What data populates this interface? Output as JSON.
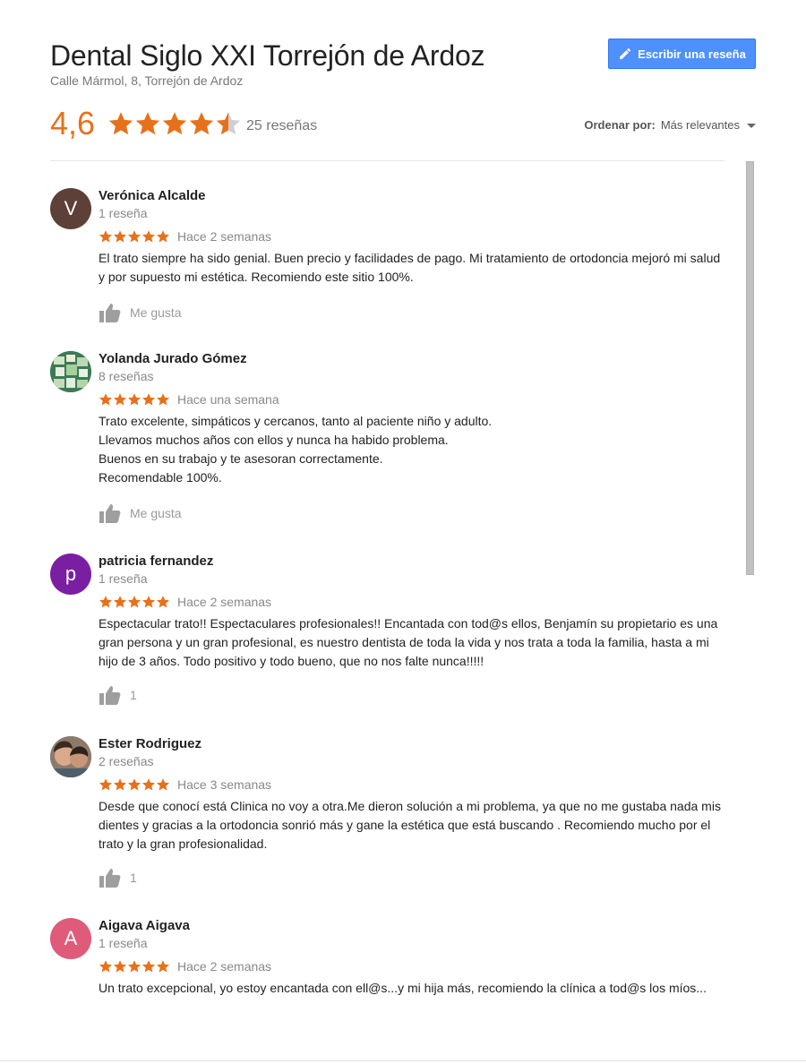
{
  "header": {
    "title": "Dental Siglo XXI Torrejón de Ardoz",
    "address": "Calle Mármol, 8, Torrejón de Ardoz",
    "write_review_label": "Escribir una reseña"
  },
  "summary": {
    "rating": "4,6",
    "rating_value": 4.6,
    "review_count": "25 reseñas",
    "sort_label": "Ordenar por:",
    "sort_value": "Más relevantes"
  },
  "colors": {
    "star": "#e7711b",
    "button": "#4d90fe",
    "avatar_v": "#5d4037",
    "avatar_p": "#7b1fa2",
    "avatar_a": "#e05a7a"
  },
  "reviews": [
    {
      "name": "Verónica Alcalde",
      "count": "1 reseña",
      "stars": 5,
      "time": "Hace 2 semanas",
      "avatar_letter": "V",
      "text": [
        "El trato siempre ha sido genial. Buen precio y facilidades de pago. Mi tratamiento de ortodoncia mejoró mi salud y por supuesto mi estética. Recomiendo este sitio 100%."
      ],
      "like_label": "Me gusta"
    },
    {
      "name": "Yolanda Jurado Gómez",
      "count": "8 reseñas",
      "stars": 5,
      "time": "Hace una semana",
      "avatar_letter": "",
      "text": [
        "Trato excelente, simpáticos y cercanos, tanto al paciente niño y adulto.",
        "Llevamos muchos años con ellos y nunca ha habido problema.",
        "Buenos en su trabajo y te asesoran correctamente.",
        "Recomendable 100%."
      ],
      "like_label": "Me gusta"
    },
    {
      "name": "patricia fernandez",
      "count": "1 reseña",
      "stars": 5,
      "time": "Hace 2 semanas",
      "avatar_letter": "p",
      "text": [
        "Espectacular trato!! Espectaculares profesionales!!  Encantada con tod@s ellos, Benjamín su propietario es una gran persona y un gran profesional, es nuestro dentista de toda la vida y nos trata a toda la familia, hasta a mi hijo de 3 años. Todo positivo y todo bueno, que no nos falte nunca!!!!!"
      ],
      "like_label": "1"
    },
    {
      "name": "Ester Rodriguez",
      "count": "2 reseñas",
      "stars": 5,
      "time": "Hace 3 semanas",
      "avatar_letter": "",
      "text": [
        "Desde que conocí está Clinica no voy a otra.Me dieron solución a mi problema, ya que no me gustaba nada mis dientes y gracias a la ortodoncia sonrió más y gane la estética que está buscando . Recomiendo mucho por el trato y la gran profesionalidad."
      ],
      "like_label": "1"
    },
    {
      "name": "Aigava Aigava",
      "count": "1 reseña",
      "stars": 5,
      "time": "Hace 2 semanas",
      "avatar_letter": "A",
      "text": [
        "Un trato excepcional, yo estoy encantada con ell@s...y mi hija más, recomiendo la clínica a tod@s los míos..."
      ],
      "like_label": ""
    }
  ]
}
